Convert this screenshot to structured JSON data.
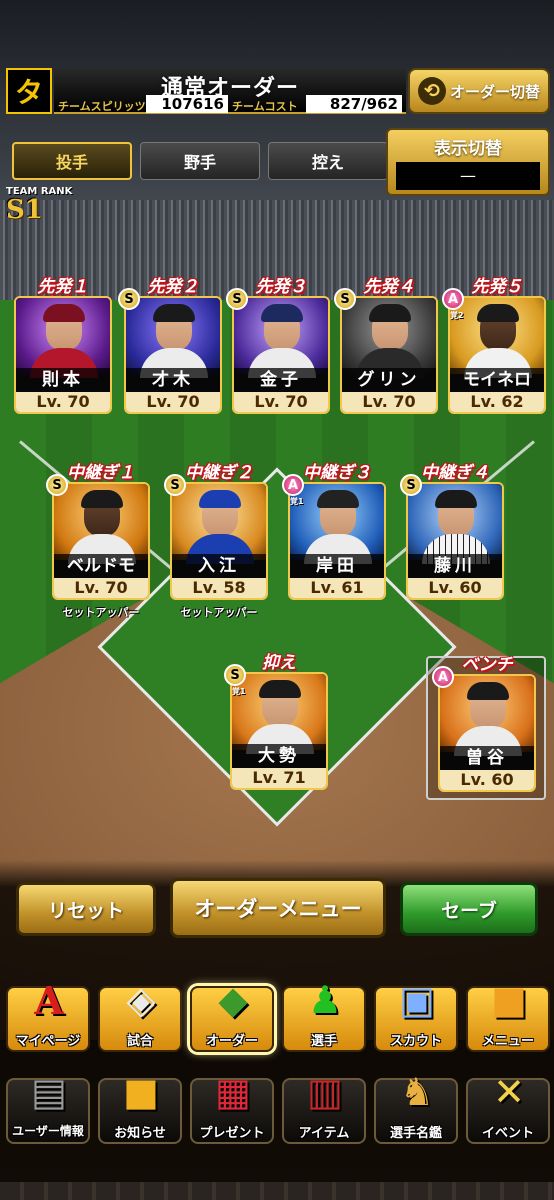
{
  "header": {
    "team_logo_glyph": "タ",
    "title": "通常オーダー",
    "spirits_label": "チームスピリッツ",
    "spirits_value": "107616",
    "cost_label": "チームコスト",
    "cost_value": "827/962",
    "order_switch_label": "オーダー切替"
  },
  "tabs": [
    {
      "label": "投手",
      "active": true
    },
    {
      "label": "野手",
      "active": false
    },
    {
      "label": "控え",
      "active": false
    }
  ],
  "display_switch": {
    "label": "表示切替",
    "value": "—"
  },
  "team_rank": {
    "label": "TEAM RANK",
    "value": "S1"
  },
  "starters": [
    {
      "position": "先発１",
      "name": "則本",
      "level": "Lv. 70",
      "badge": ""
    },
    {
      "position": "先発２",
      "name": "才木",
      "level": "Lv. 70",
      "badge": "S"
    },
    {
      "position": "先発３",
      "name": "金子",
      "level": "Lv. 70",
      "badge": "S"
    },
    {
      "position": "先発４",
      "name": "グリン",
      "level": "Lv. 70",
      "badge": "S"
    },
    {
      "position": "先発５",
      "name": "モイネロ",
      "level": "Lv. 62",
      "badge": "A",
      "badge_sub": "覚2"
    }
  ],
  "relievers": [
    {
      "position": "中継ぎ１",
      "name": "ベルドモ",
      "level": "Lv. 70",
      "badge": "S",
      "role": "セットアッパー"
    },
    {
      "position": "中継ぎ２",
      "name": "入江",
      "level": "Lv. 58",
      "badge": "S",
      "role": "セットアッパー"
    },
    {
      "position": "中継ぎ３",
      "name": "岸田",
      "level": "Lv. 61",
      "badge": "A",
      "badge_sub": "覚1",
      "role": ""
    },
    {
      "position": "中継ぎ４",
      "name": "藤川",
      "level": "Lv. 60",
      "badge": "S",
      "role": ""
    }
  ],
  "closer": {
    "position": "抑え",
    "name": "大勢",
    "level": "Lv. 71",
    "badge": "S",
    "badge_sub": "覚1"
  },
  "bench": {
    "position": "ベンチ",
    "name": "曽谷",
    "level": "Lv. 60",
    "badge": "A"
  },
  "actions": {
    "reset": "リセット",
    "order_menu": "オーダーメニュー",
    "save": "セーブ"
  },
  "nav_top": [
    {
      "label": "マイページ",
      "icon": "mypage-icon"
    },
    {
      "label": "試合",
      "icon": "game-icon"
    },
    {
      "label": "オーダー",
      "icon": "order-icon",
      "selected": true
    },
    {
      "label": "選手",
      "icon": "player-icon"
    },
    {
      "label": "スカウト",
      "icon": "scout-icon"
    },
    {
      "label": "メニュー",
      "icon": "menu-icon"
    }
  ],
  "nav_bottom": [
    {
      "label": "ユーザー情報",
      "icon": "user-info-icon"
    },
    {
      "label": "お知らせ",
      "icon": "notice-icon"
    },
    {
      "label": "プレゼント",
      "icon": "present-icon"
    },
    {
      "label": "アイテム",
      "icon": "item-icon"
    },
    {
      "label": "選手名鑑",
      "icon": "directory-icon"
    },
    {
      "label": "イベント",
      "icon": "event-icon"
    }
  ],
  "colors": {
    "accent_gold": "#f2c84a",
    "position_red": "#c0141a",
    "save_green": "#2e9a2a"
  }
}
